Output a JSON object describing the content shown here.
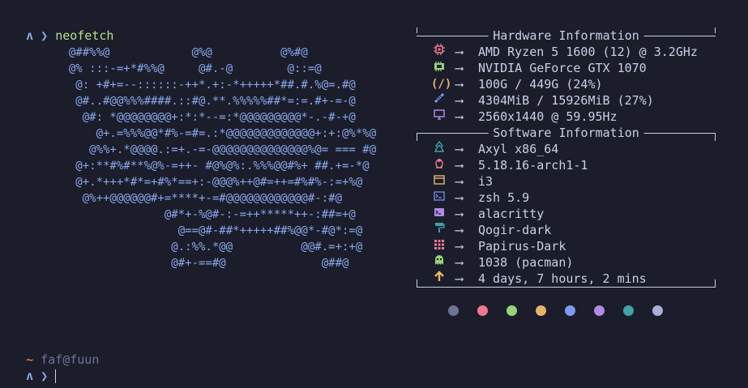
{
  "prompt": {
    "logo": "ʌ",
    "chevron": "❯",
    "command": "neofetch"
  },
  "ascii_art": [
    "  @##%%@            @%@          @%#@",
    "  @% :::-=+*#%%@     @#.-@        @::=@",
    "   @: +#+=--::::::-++*.+:-*+++++*##.#.%@=.#@",
    "   @#..#@@%%%####.::#@.**.%%%%%##*=:=.#+-=-@",
    "    @#: *@@@@@@@@+:*:*--=:*@@@@@@@@@*-.-#-+@",
    "      @+.=%%%@@*#%-=#=.:*@@@@@@@@@@@@@+:+:@%*%@",
    "     @%%+.*@@@@.:=+.-=-@@@@@@@@@@@@@@%@= === #@",
    "   @+:**#%#**%@%-=++- #@%@%:.%%%@@#%+ ##.+=-*@",
    "   @+.*+++*#*=+#%*==+:-@@@%++@#=++=#%#%-:=+%@",
    "    @%++@@@@@@#+=****+-=#@@@@@@@@@@@@#-:#@",
    "                @#*+-%@#-:-=++*****++-:##=+@",
    "                  @==@#-##*+++++##%@@*-#@*:=@",
    "                 @.:%%.*@@          @@#.=+:+@",
    "                 @#+-==#@              @##@"
  ],
  "hardware": {
    "title": "Hardware Information",
    "rows": [
      {
        "icon": "cpu-icon",
        "value": "AMD Ryzen 5 1600 (12) @ 3.2GHz"
      },
      {
        "icon": "gpu-icon",
        "value": "NVIDIA GeForce GTX 1070"
      },
      {
        "icon": "disk-icon",
        "value": "100G / 449G (24%)"
      },
      {
        "icon": "memory-icon",
        "value": "4304MiB / 15926MiB (27%)"
      },
      {
        "icon": "monitor-icon",
        "value": "2560x1440 @ 59.95Hz"
      }
    ]
  },
  "software": {
    "title": "Software Information",
    "rows": [
      {
        "icon": "distro-icon",
        "value": "Axyl x86_64"
      },
      {
        "icon": "kernel-icon",
        "value": "5.18.16-arch1-1"
      },
      {
        "icon": "wm-icon",
        "value": "i3"
      },
      {
        "icon": "shell-icon",
        "value": "zsh 5.9"
      },
      {
        "icon": "terminal-icon",
        "value": "alacritty"
      },
      {
        "icon": "theme-icon",
        "value": "Qogir-dark"
      },
      {
        "icon": "icons-icon",
        "value": "Papirus-Dark"
      },
      {
        "icon": "packages-icon",
        "value": "1038 (pacman)"
      },
      {
        "icon": "uptime-icon",
        "value": "4 days, 7 hours, 2 mins"
      }
    ]
  },
  "arrow": "⟶",
  "palette": [
    "#6d7595",
    "#f07890",
    "#9ad27a",
    "#e8b46a",
    "#7b9cf0",
    "#b08ae8",
    "#3fa3a8",
    "#a9b0d6"
  ],
  "second_prompt": {
    "tilde": "~",
    "userhost": "faf@fuun",
    "logo": "ʌ",
    "chevron": "❯"
  }
}
